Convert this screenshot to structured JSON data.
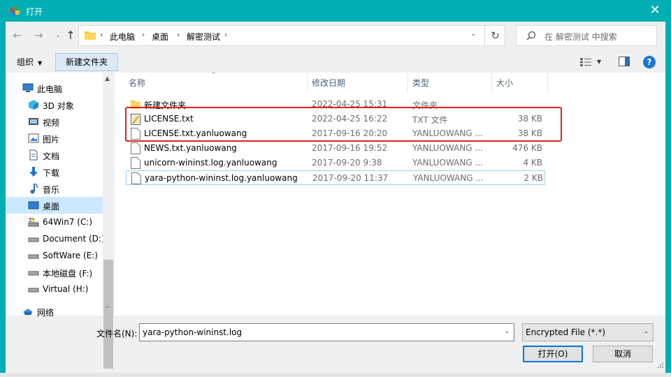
{
  "window": {
    "title": "打开",
    "close_glyph": "✕"
  },
  "nav": {
    "back_glyph": "←",
    "forward_glyph": "→",
    "recent_glyph": "⌄",
    "up_glyph": "↑"
  },
  "address": {
    "segments": [
      "此电脑",
      "桌面",
      "解密测试"
    ],
    "separator": "›",
    "dropdown_glyph": "⌄",
    "refresh_glyph": "↻"
  },
  "search": {
    "placeholder": "在 解密测试 中搜索"
  },
  "toolbar": {
    "organize_label": "组织",
    "organize_caret": "▼",
    "new_folder_label": "新建文件夹",
    "view_caret": "▼",
    "help_glyph": "?"
  },
  "sidebar": {
    "items": [
      {
        "label": "此电脑",
        "icon": "computer-icon"
      },
      {
        "label": "3D 对象",
        "icon": "3d-objects-icon"
      },
      {
        "label": "视频",
        "icon": "video-folder-icon"
      },
      {
        "label": "图片",
        "icon": "pictures-folder-icon"
      },
      {
        "label": "文档",
        "icon": "documents-folder-icon"
      },
      {
        "label": "下载",
        "icon": "download-icon"
      },
      {
        "label": "音乐",
        "icon": "music-icon"
      },
      {
        "label": "桌面",
        "icon": "desktop-icon",
        "selected": true
      },
      {
        "label": "64Win7  (C:)",
        "icon": "system-drive-icon"
      },
      {
        "label": "Document (D:)",
        "icon": "drive-icon"
      },
      {
        "label": "SoftWare (E:)",
        "icon": "drive-icon"
      },
      {
        "label": "本地磁盘 (F:)",
        "icon": "drive-icon"
      },
      {
        "label": "Virtual (H:)",
        "icon": "drive-icon"
      },
      {
        "label": "网络",
        "icon": "network-icon"
      }
    ],
    "scroll_up_glyph": "▲",
    "scroll_down_glyph": "⌄"
  },
  "file_list": {
    "columns": [
      "名称",
      "修改日期",
      "类型",
      "大小"
    ],
    "sort_glyph": "^",
    "rows": [
      {
        "name": "新建文件夹",
        "date": "2022-04-25 15:31",
        "type": "文件夹",
        "size": "",
        "icon": "folder-icon"
      },
      {
        "name": "LICENSE.txt",
        "date": "2022-04-25 16:22",
        "type": "TXT 文件",
        "size": "38 KB",
        "icon": "text-file-icon"
      },
      {
        "name": "LICENSE.txt.yanluowang",
        "date": "2017-09-16 20:20",
        "type": "YANLUOWANG ...",
        "size": "38 KB",
        "icon": "blank-file-icon"
      },
      {
        "name": "NEWS.txt.yanluowang",
        "date": "2017-09-16 19:52",
        "type": "YANLUOWANG ...",
        "size": "476 KB",
        "icon": "blank-file-icon"
      },
      {
        "name": "unicorn-wininst.log.yanluowang",
        "date": "2017-09-20 9:38",
        "type": "YANLUOWANG ...",
        "size": "4 KB",
        "icon": "blank-file-icon"
      },
      {
        "name": "yara-python-wininst.log.yanluowang",
        "date": "2017-09-20 11:37",
        "type": "YANLUOWANG ...",
        "size": "2 KB",
        "icon": "blank-file-icon"
      }
    ]
  },
  "bottom": {
    "filename_label": "文件名(N):",
    "filename_value": "yara-python-wininst.log",
    "filter_value": "Encrypted File (*.*)",
    "dropdown_glyph": "⌄",
    "open_label": "打开(O)",
    "cancel_label": "取消"
  },
  "colors": {
    "titlebar": "#00aeb4",
    "selection": "#cce8ff",
    "annotation_box": "#e0201c",
    "accent": "#0078d7"
  }
}
